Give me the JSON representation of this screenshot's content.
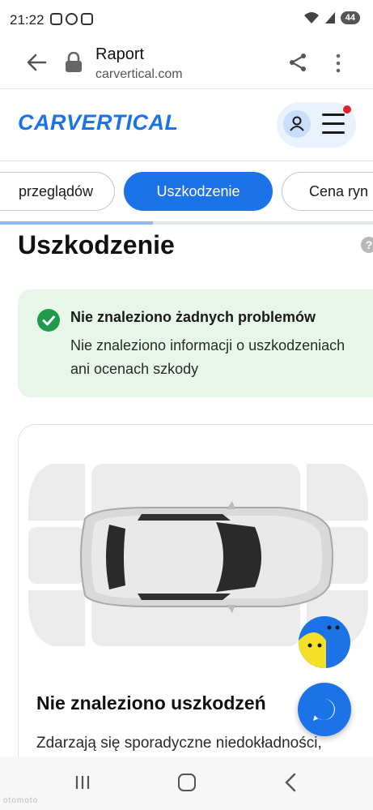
{
  "status_bar": {
    "time": "21:22",
    "battery": "44"
  },
  "browser": {
    "title": "Raport",
    "url": "carvertical.com"
  },
  "site": {
    "logo": "CARVERTICAL"
  },
  "tabs": [
    {
      "label": "przeglądów",
      "active": false
    },
    {
      "label": "Uszkodzenie",
      "active": true
    },
    {
      "label": "Cena ryn",
      "active": false
    }
  ],
  "tabs_scroll_progress": 0.41,
  "section": {
    "title": "Uszkodzenie",
    "help": "?"
  },
  "success": {
    "title": "Nie znaleziono żadnych problemów",
    "text": "Nie znaleziono informacji o uszkodzeniach ani ocenach szkody"
  },
  "damage": {
    "title": "Nie znaleziono uszkodzeń",
    "text": "Zdarzają się sporadyczne niedokładności,"
  },
  "watermark": "otomoto",
  "colors": {
    "brand": "#1c73e8",
    "success_bg": "#e8f6ea",
    "success_icon": "#1e9b4b",
    "notification": "#e2232f"
  }
}
